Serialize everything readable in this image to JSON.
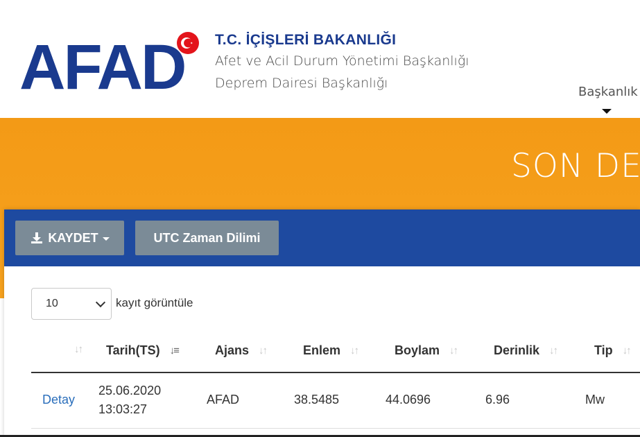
{
  "header": {
    "logo_text": "AFAD",
    "org_title": "T.C. İÇİŞLERİ BAKANLIĞI",
    "org_line1": "Afet ve Acil Durum Yönetimi Başkanlığı",
    "org_line2": "Deprem Dairesi Başkanlığı",
    "nav_item": "Başkanlık",
    "colors": {
      "brand": "#1a3a8e",
      "flag": "#e3141b"
    }
  },
  "banner": {
    "title": "SON DEP",
    "color": "#f39a16"
  },
  "toolbar": {
    "save_label": "KAYDET",
    "utc_label": "UTC Zaman Dilimi",
    "color": "#1e4aa0"
  },
  "length": {
    "value": "10",
    "label": "kayıt görüntüle"
  },
  "table": {
    "columns": [
      "",
      "Tarih(TS)",
      "Ajans",
      "Enlem",
      "Boylam",
      "Derinlik",
      "Tip"
    ],
    "rows": [
      {
        "detail": "Detay",
        "date": "25.06.2020",
        "time": "13:03:27",
        "agency": "AFAD",
        "lat": "38.5485",
        "lon": "44.0696",
        "depth": "6.96",
        "type": "Mw"
      }
    ]
  }
}
